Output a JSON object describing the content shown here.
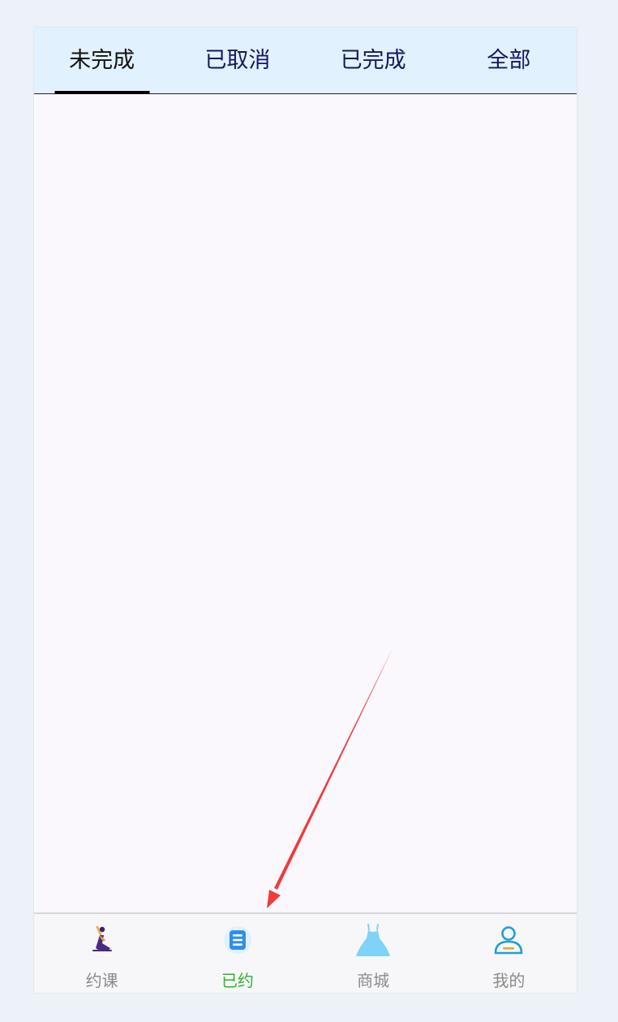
{
  "tabs": [
    {
      "label": "未完成",
      "active": true
    },
    {
      "label": "已取消",
      "active": false
    },
    {
      "label": "已完成",
      "active": false
    },
    {
      "label": "全部",
      "active": false
    }
  ],
  "bottom_nav": [
    {
      "label": "约课",
      "icon": "yoga-pose-icon",
      "active": false
    },
    {
      "label": "已约",
      "icon": "booked-list-icon",
      "active": true
    },
    {
      "label": "商城",
      "icon": "dress-icon",
      "active": false
    },
    {
      "label": "我的",
      "icon": "user-profile-icon",
      "active": false
    }
  ],
  "colors": {
    "tabbar_bg": "#e1f1fd",
    "tab_text": "#16175e",
    "nav_active": "#2db52d",
    "nav_inactive": "#8a8a8a",
    "annotation_arrow": "#ef3b3b"
  }
}
